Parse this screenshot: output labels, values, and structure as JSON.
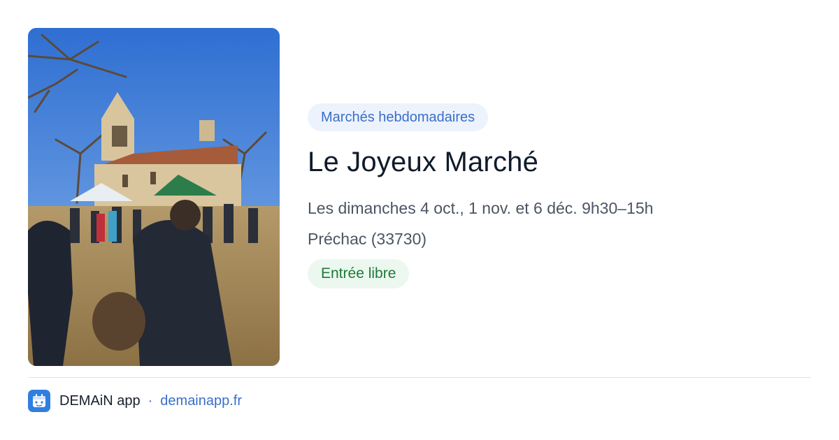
{
  "event": {
    "image_alt": "Marché de plein air devant une église",
    "category": "Marchés hebdomadaires",
    "title": "Le Joyeux Marché",
    "dates": "Les dimanches 4 oct., 1 nov. et 6 déc. 9h30–15h",
    "location": "Préchac (33730)",
    "entry": "Entrée libre"
  },
  "footer": {
    "app_icon": "demain-app-icon",
    "app_name": "DEMAiN app",
    "separator": "·",
    "link_text": "demainapp.fr"
  },
  "colors": {
    "accent": "#3a6fc9",
    "category_chip_bg": "#edf3fc",
    "entry_chip_bg": "#ecf8ef",
    "entry_chip_text": "#1d7a38",
    "app_icon_bg": "#2f7fe0"
  }
}
